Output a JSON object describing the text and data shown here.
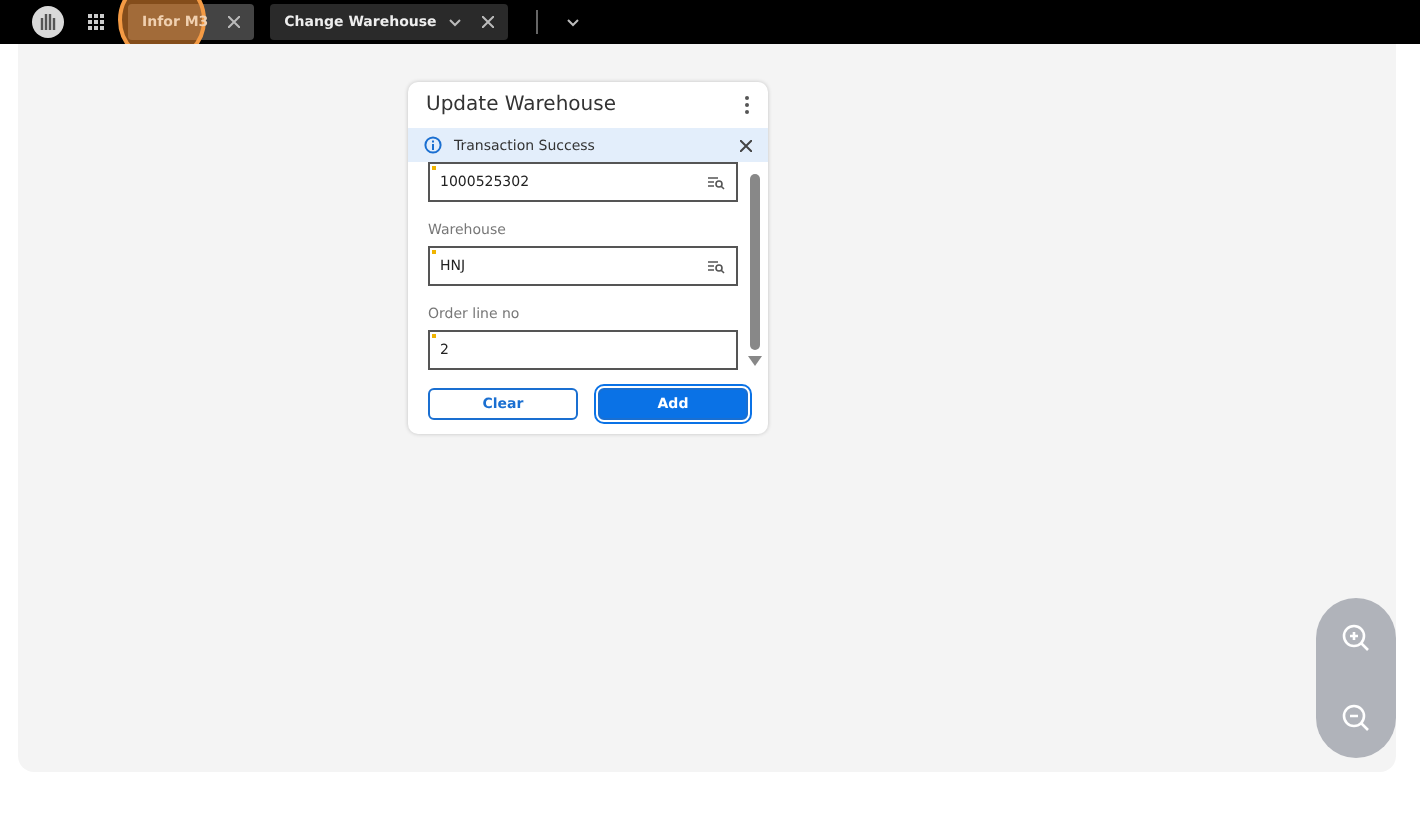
{
  "top_bar": {
    "tabs": [
      {
        "label": "Infor M3",
        "selected": true,
        "kind": "app"
      },
      {
        "label": "Change Warehouse",
        "selected": false,
        "kind": "page"
      }
    ]
  },
  "dialog": {
    "title": "Update Warehouse",
    "message": {
      "text": "Transaction Success"
    },
    "fields": [
      {
        "value": "1000525302",
        "kind": "lookup",
        "required": true
      },
      {
        "label": "Warehouse",
        "value": "HNJ",
        "kind": "lookup",
        "required": true
      },
      {
        "label": "Order line no",
        "value": "2",
        "kind": "text",
        "required": true
      }
    ],
    "buttons": [
      {
        "label": "Clear",
        "kind": "secondary"
      },
      {
        "label": "Add",
        "kind": "primary"
      }
    ]
  }
}
